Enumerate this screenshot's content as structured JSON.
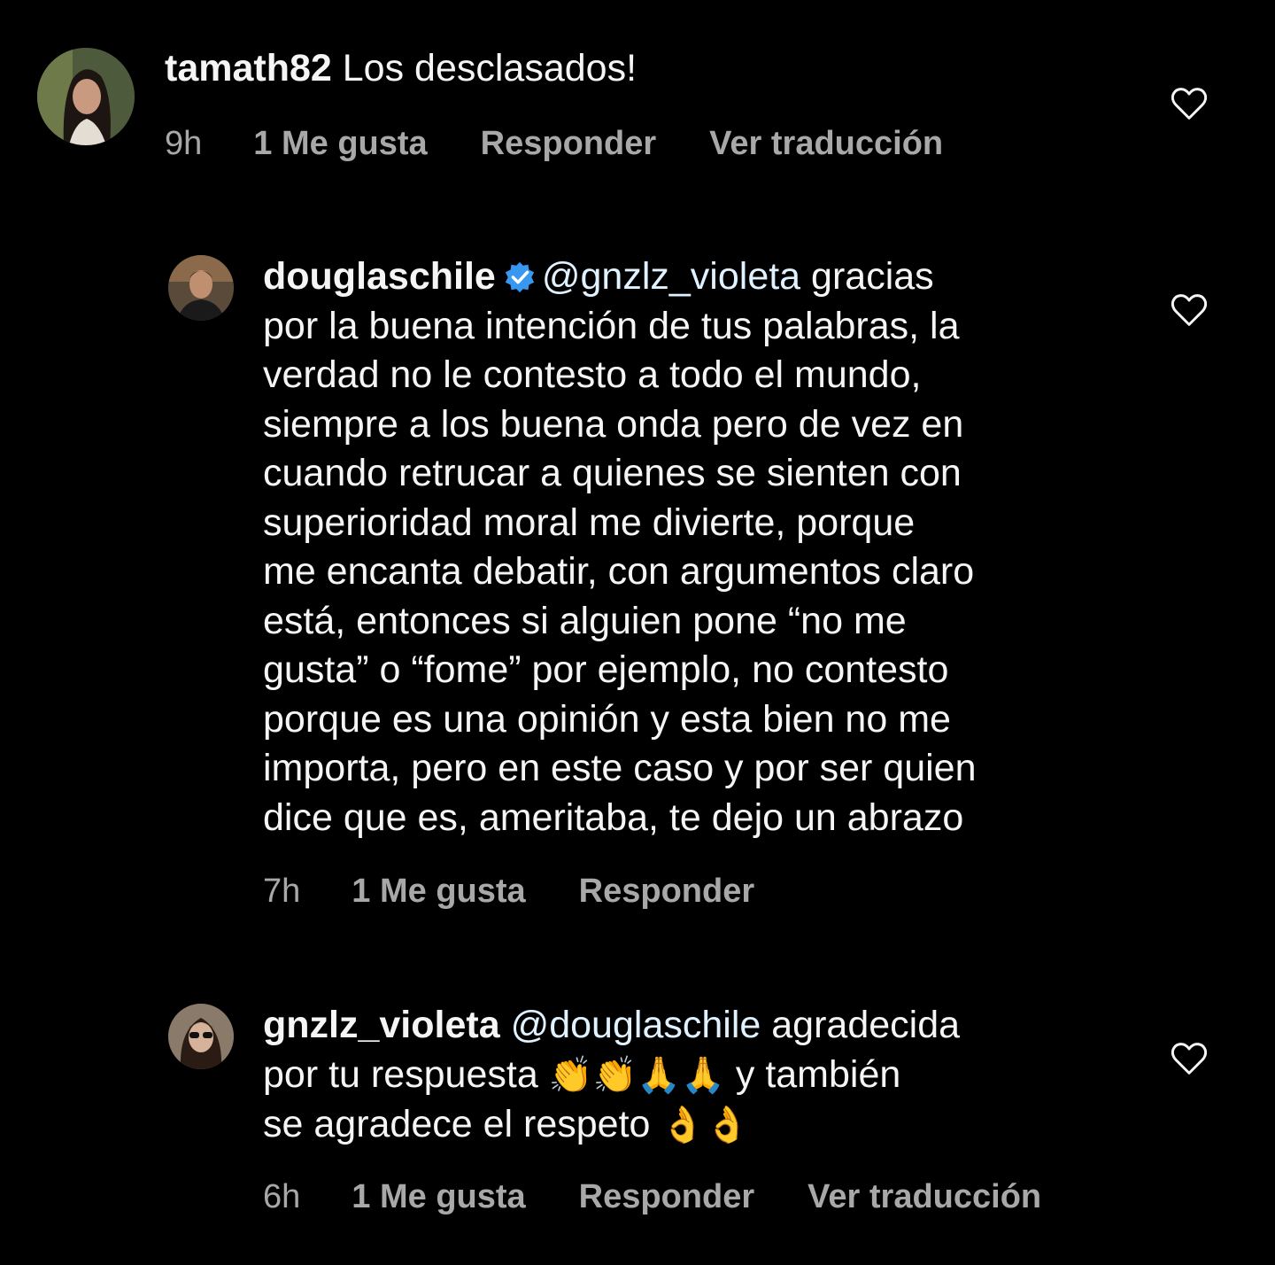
{
  "colors": {
    "background": "#000000",
    "text": "#f5f5f5",
    "meta": "#a8a8a8",
    "mention": "#e0f1ff",
    "verified": "#3897f0"
  },
  "comments": [
    {
      "username": "tamath82",
      "text_lines": [
        "Los desclasados!"
      ],
      "time": "9h",
      "likes": "1 Me gusta",
      "reply": "Responder",
      "translate": "Ver traducción",
      "icons": {
        "avatar": "avatar-woman-dark-hair",
        "like": "heart-outline-icon"
      }
    },
    {
      "username": "douglaschile",
      "verified": true,
      "mention": "@gnzlz_violeta",
      "first_line_rest": "gracias",
      "text_lines": [
        "por la buena intención de tus palabras,  la",
        "verdad no le contesto a todo el mundo,",
        "siempre a los buena onda pero de vez en",
        "cuando retrucar a quienes se sienten con",
        "superioridad moral me divierte, porque",
        "me encanta debatir, con argumentos claro",
        "está, entonces si alguien pone “no me",
        "gusta” o “fome” por ejemplo, no contesto",
        "porque es una opinión y esta bien no me",
        "importa, pero en este caso y por ser quien",
        "dice que es, ameritaba, te dejo un abrazo"
      ],
      "time": "7h",
      "likes": "1 Me gusta",
      "reply": "Responder",
      "icons": {
        "avatar": "avatar-man",
        "verified": "verified-badge-icon",
        "like": "heart-outline-icon"
      }
    },
    {
      "username": "gnzlz_violeta",
      "mention": "@douglaschile",
      "first_line_rest": "agradecida",
      "line2_text": "por tu respuesta",
      "line2_emoji": "👏👏🙏🙏",
      "line2_tail": "y también",
      "line3_text": "se agradece el respeto",
      "line3_emoji": "👌👌",
      "time": "6h",
      "likes": "1 Me gusta",
      "reply": "Responder",
      "translate": "Ver traducción",
      "icons": {
        "avatar": "avatar-woman-sunglasses",
        "like": "heart-outline-icon"
      }
    }
  ]
}
